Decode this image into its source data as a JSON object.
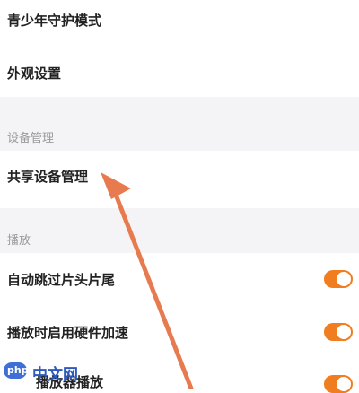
{
  "settings": {
    "rows": [
      {
        "label": "青少年守护模式"
      },
      {
        "label": "外观设置"
      },
      {
        "label": "共享设备管理"
      },
      {
        "label": "自动跳过片头片尾",
        "toggle_on": true
      },
      {
        "label": "播放时启用硬件加速",
        "toggle_on": true
      },
      {
        "label": "播放器播放",
        "toggle_on": true
      }
    ],
    "sections": [
      {
        "title": "设备管理"
      },
      {
        "title": "播放"
      }
    ]
  },
  "colors": {
    "accent": "#f07d1f",
    "annotation_arrow": "#e87a4f",
    "section_background": "#f4f4f6"
  },
  "watermark": {
    "logo_text": "php",
    "text": "中文网"
  }
}
